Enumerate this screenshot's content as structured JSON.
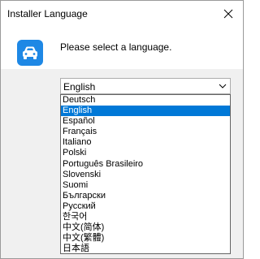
{
  "window": {
    "title": "Installer Language"
  },
  "icons": {
    "close": "close-icon",
    "app": "car-icon",
    "dropdown_arrow": "chevron-down-icon"
  },
  "colors": {
    "app_icon_bg": "#1e88e5",
    "selection": "#0078d7"
  },
  "dialog": {
    "prompt": "Please select a language."
  },
  "language_select": {
    "selected": "English",
    "options": [
      "Deutsch",
      "English",
      "Español",
      "Français",
      "Italiano",
      "Polski",
      "Português Brasileiro",
      "Slovenski",
      "Suomi",
      "Български",
      "Русский",
      "한국어",
      "中文(简体)",
      "中文(繁體)",
      "日本語"
    ],
    "highlighted_index": 1
  }
}
